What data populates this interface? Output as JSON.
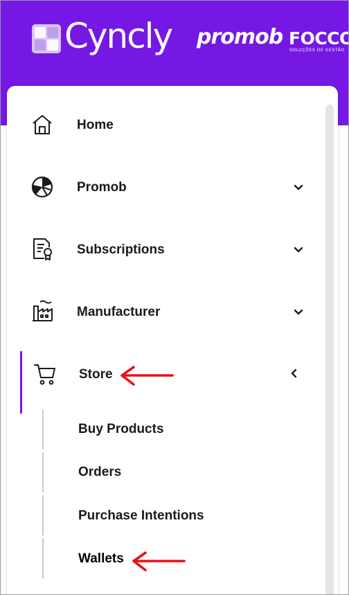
{
  "brand": {
    "name": "Cyncly",
    "partner_1": "promob",
    "partner_2": "FOCCO",
    "partner_2_tagline": "SOLUÇÕES DE GESTÃO"
  },
  "colors": {
    "header": "#7518e3",
    "active_indicator": "#7518e3",
    "annotation_arrow": "#e8101a"
  },
  "nav": {
    "items": [
      {
        "label": "Home",
        "icon": "home-icon",
        "expandable": false
      },
      {
        "label": "Promob",
        "icon": "promob-icon",
        "expandable": true,
        "expanded": false
      },
      {
        "label": "Subscriptions",
        "icon": "subscription-certificate-icon",
        "expandable": true,
        "expanded": false
      },
      {
        "label": "Manufacturer",
        "icon": "factory-icon",
        "expandable": true,
        "expanded": false
      },
      {
        "label": "Store",
        "icon": "shopping-cart-icon",
        "expandable": true,
        "expanded": true,
        "active": true
      }
    ],
    "store_submenu": [
      {
        "label": "Buy Products",
        "emphasized": false
      },
      {
        "label": "Orders",
        "emphasized": false
      },
      {
        "label": "Purchase Intentions",
        "emphasized": false
      },
      {
        "label": "Wallets",
        "emphasized": true
      }
    ]
  }
}
